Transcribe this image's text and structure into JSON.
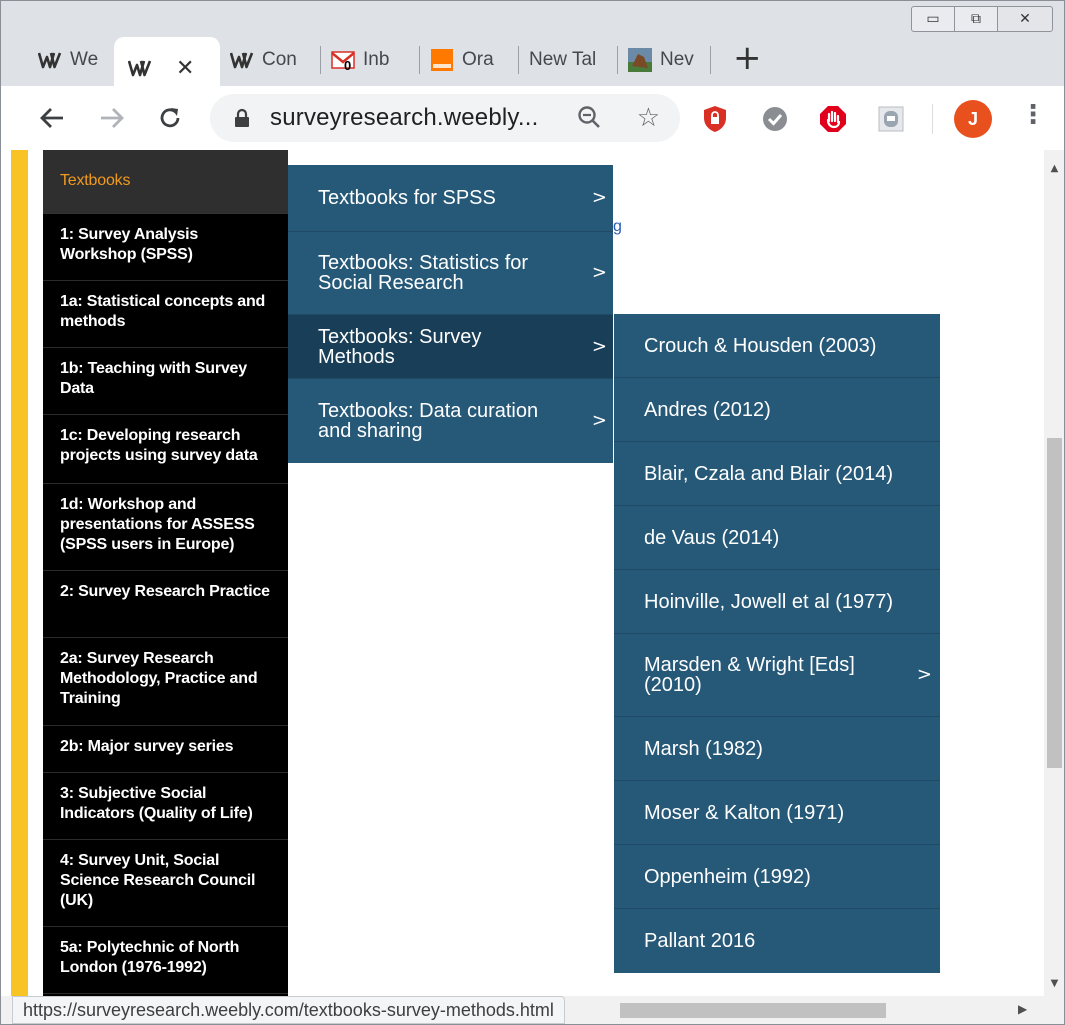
{
  "browser": {
    "tabs": [
      {
        "title": "We",
        "icon": "weebly-icon",
        "active": false
      },
      {
        "title": "",
        "icon": "weebly-icon",
        "active": true
      },
      {
        "title": "Con",
        "icon": "weebly-icon",
        "active": false
      },
      {
        "title": "Inb",
        "icon": "gmail-icon",
        "badge": "0",
        "active": false
      },
      {
        "title": "Ora",
        "icon": "orange-icon",
        "active": false
      },
      {
        "title": "New Tal",
        "icon": "",
        "active": false
      },
      {
        "title": "Nev",
        "icon": "bird-icon",
        "active": false
      }
    ],
    "close_glyph": "✕",
    "new_tab_glyph": "+",
    "url": "surveyresearch.weebly...",
    "avatar_letter": "J",
    "status_url": "https://surveyresearch.weebly.com/textbooks-survey-methods.html",
    "window_controls": {
      "minimize": "▭",
      "maximize": "⧉",
      "close": "✕"
    }
  },
  "sidebar": {
    "items": [
      {
        "label": "Textbooks",
        "active": true
      },
      {
        "label": "1: Survey Analysis Workshop (SPSS)"
      },
      {
        "label": "1a: Statistical concepts and methods"
      },
      {
        "label": "1b: Teaching with Survey Data"
      },
      {
        "label": "1c: Developing research projects using survey data"
      },
      {
        "label": "1d: Workshop and presentations for ASSESS (SPSS users in Europe)"
      },
      {
        "label": "2: Survey Research Practice"
      },
      {
        "label": "2a: Survey Research Methodology, Practice and Training"
      },
      {
        "label": "2b: Major survey series"
      },
      {
        "label": "3: Subjective Social Indicators (Quality of Life)"
      },
      {
        "label": "4: Survey Unit, Social Science Research Council (UK)"
      },
      {
        "label": "5a: Polytechnic of North London (1976-1992)"
      }
    ]
  },
  "submenu": {
    "chevron": ">",
    "items": [
      {
        "label": "Textbooks for SPSS"
      },
      {
        "label": "Textbooks: Statistics for Social Research"
      },
      {
        "label": "Textbooks: Survey Methods",
        "highlighted": true
      },
      {
        "label": "Textbooks: Data curation and sharing"
      }
    ]
  },
  "survey_methods_menu": {
    "items": [
      {
        "label": "Crouch & Housden (2003)"
      },
      {
        "label": "Andres (2012)"
      },
      {
        "label": "Blair, Czala and Blair (2014)"
      },
      {
        "label": "de Vaus (2014)"
      },
      {
        "label": "Hoinville, Jowell et al (1977)"
      },
      {
        "label": "Marsden & Wright [Eds] (2010)",
        "has_submenu": true
      },
      {
        "label": "Marsh (1982)"
      },
      {
        "label": "Moser & Kalton (1971)"
      },
      {
        "label": "Oppenheim (1992)"
      },
      {
        "label": "Pallant 2016"
      }
    ]
  },
  "page": {
    "stray_text": "g"
  },
  "colors": {
    "menu_bg": "#265878",
    "menu_highlight": "#193e57",
    "accent_yellow": "#f7c325",
    "active_orange": "#f29a1f",
    "avatar": "#e8501e"
  }
}
